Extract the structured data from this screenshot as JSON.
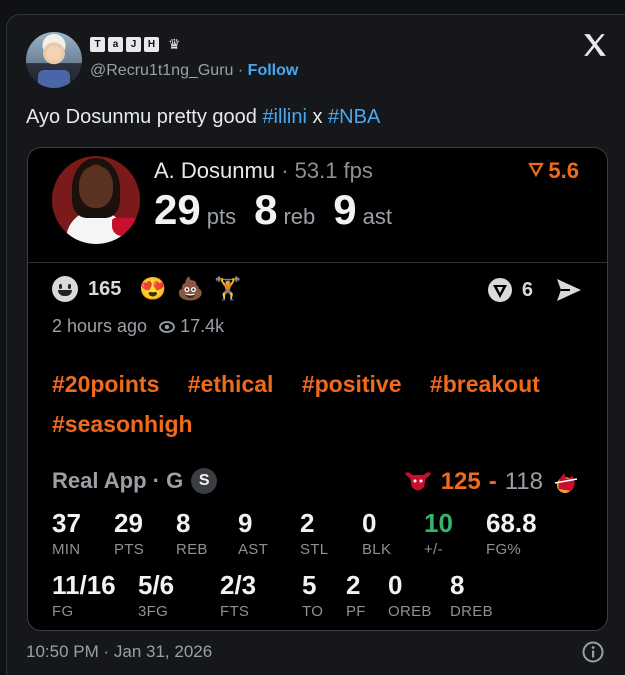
{
  "author": {
    "display_letters": [
      "T",
      "a",
      "J",
      "H"
    ],
    "crown_icon": "♛",
    "handle": "@Recru1t1ng_Guru",
    "separator": "·",
    "follow_label": "Follow"
  },
  "tweet": {
    "text_before": "Ayo Dosunmu pretty good ",
    "tag1": "#illini",
    "text_mid": " x ",
    "tag2": "#NBA"
  },
  "card": {
    "player_name": "A. Dosunmu",
    "fps": "· 53.1 fps",
    "score_badge": "5.6",
    "statline": [
      {
        "value": "29",
        "unit": "pts"
      },
      {
        "value": "8",
        "unit": "reb"
      },
      {
        "value": "9",
        "unit": "ast"
      }
    ],
    "reactions": {
      "count": "165",
      "emoji_1": "😍",
      "emoji_2": "💩",
      "emoji_3": "🏋",
      "votes_count": "6"
    },
    "posted_ago": "2 hours ago",
    "views": "17.4k",
    "hashtags": [
      "#20points",
      "#ethical",
      "#positive",
      "#breakout",
      "#seasonhigh"
    ],
    "source_label": "Real App · G",
    "source_badge": "S",
    "game": {
      "home_score": "125",
      "dash": "-",
      "away_score": "118"
    },
    "box_row1": [
      {
        "value": "37",
        "label": "MIN"
      },
      {
        "value": "29",
        "label": "PTS"
      },
      {
        "value": "8",
        "label": "REB"
      },
      {
        "value": "9",
        "label": "AST"
      },
      {
        "value": "2",
        "label": "STL"
      },
      {
        "value": "0",
        "label": "BLK"
      },
      {
        "value": "10",
        "label": "+/-"
      },
      {
        "value": "68.8",
        "label": "FG%"
      }
    ],
    "box_row2": [
      {
        "value": "11/16",
        "label": "FG"
      },
      {
        "value": "5/6",
        "label": "3FG"
      },
      {
        "value": "2/3",
        "label": "FTS"
      },
      {
        "value": "5",
        "label": "TO"
      },
      {
        "value": "2",
        "label": "PF"
      },
      {
        "value": "0",
        "label": "OREB"
      },
      {
        "value": "8",
        "label": "DREB"
      }
    ]
  },
  "footer": {
    "timestamp": "10:50 PM · Jan 31, 2026"
  },
  "colors": {
    "accent_orange": "#f06a1c",
    "link_blue": "#4aa8f0",
    "positive_green": "#2fb86b"
  }
}
